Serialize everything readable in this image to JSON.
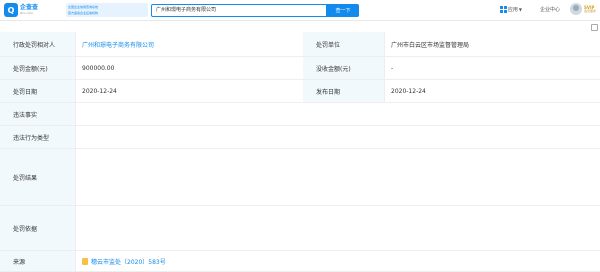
{
  "header": {
    "logo_cn": "企查查",
    "logo_en": "Qcc.com",
    "slogan_line1": "全国企业信用查询系统",
    "slogan_line2": "官方备案企业征信机构",
    "search_value": "广州和璟电子商务有限公司",
    "search_button": "查一下",
    "app_label": "应用",
    "enterprise_center": "企业中心",
    "vip_label": "SVIP",
    "vip_sub": "会员服务"
  },
  "record": {
    "rows": [
      {
        "label": "行政处罚相对人",
        "value": "广州和璟电子商务有限公司",
        "link": true
      },
      {
        "label": "处罚金额(元)",
        "value": "900000.00"
      },
      {
        "label": "处罚日期",
        "value": "2020-12-24"
      }
    ],
    "right_cells": [
      {
        "label": "处罚单位",
        "value": "广州市白云区市场监督管理局"
      },
      {
        "label": "没收金额(元)",
        "value": "-"
      },
      {
        "label": "发布日期",
        "value": "2020-12-24"
      }
    ],
    "violation_fact_label": "违法事实",
    "violation_fact": "",
    "violation_act_label": "违法行为类型",
    "violation_act": "",
    "penalty_result_label": "处罚结果",
    "penalty_result": "",
    "penalty_basis_label": "处罚依据",
    "penalty_basis": "",
    "source_label": "来源",
    "source_value": "穗云市监处〔2020〕583号"
  }
}
